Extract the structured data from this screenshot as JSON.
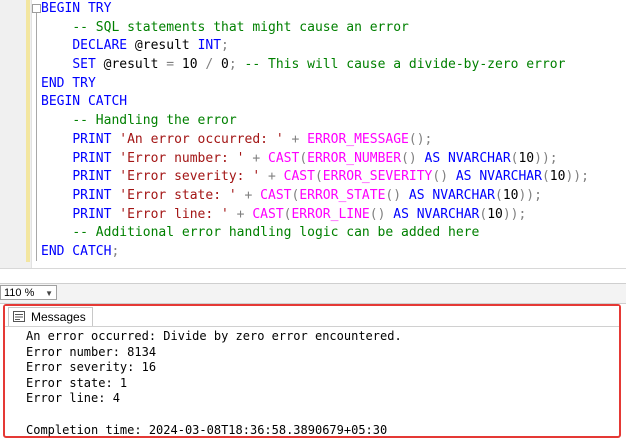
{
  "editor": {
    "lines": [
      [
        {
          "t": "BEGIN TRY",
          "c": "kw"
        }
      ],
      [
        {
          "t": "    "
        },
        {
          "t": "-- SQL statements that might cause an error",
          "c": "cm"
        }
      ],
      [
        {
          "t": "    "
        },
        {
          "t": "DECLARE",
          "c": "kw"
        },
        {
          "t": " @result "
        },
        {
          "t": "INT",
          "c": "kw"
        },
        {
          "t": ";",
          "c": "gray"
        }
      ],
      [
        {
          "t": "    "
        },
        {
          "t": "SET",
          "c": "kw"
        },
        {
          "t": " @result "
        },
        {
          "t": "=",
          "c": "gray"
        },
        {
          "t": " 10 "
        },
        {
          "t": "/",
          "c": "gray"
        },
        {
          "t": " 0"
        },
        {
          "t": ";",
          "c": "gray"
        },
        {
          "t": " "
        },
        {
          "t": "-- This will cause a divide-by-zero error",
          "c": "cm"
        }
      ],
      [
        {
          "t": "END TRY",
          "c": "kw"
        }
      ],
      [
        {
          "t": "BEGIN CATCH",
          "c": "kw"
        }
      ],
      [
        {
          "t": "    "
        },
        {
          "t": "-- Handling the error",
          "c": "cm"
        }
      ],
      [
        {
          "t": "    "
        },
        {
          "t": "PRINT",
          "c": "kw"
        },
        {
          "t": " "
        },
        {
          "t": "'An error occurred: '",
          "c": "st"
        },
        {
          "t": " + ",
          "c": "gray"
        },
        {
          "t": "ERROR_MESSAGE",
          "c": "fn"
        },
        {
          "t": "();",
          "c": "gray"
        }
      ],
      [
        {
          "t": "    "
        },
        {
          "t": "PRINT",
          "c": "kw"
        },
        {
          "t": " "
        },
        {
          "t": "'Error number: '",
          "c": "st"
        },
        {
          "t": " + ",
          "c": "gray"
        },
        {
          "t": "CAST",
          "c": "fn"
        },
        {
          "t": "(",
          "c": "gray"
        },
        {
          "t": "ERROR_NUMBER",
          "c": "fn"
        },
        {
          "t": "() ",
          "c": "gray"
        },
        {
          "t": "AS",
          "c": "kw"
        },
        {
          "t": " "
        },
        {
          "t": "NVARCHAR",
          "c": "kw"
        },
        {
          "t": "(",
          "c": "gray"
        },
        {
          "t": "10"
        },
        {
          "t": "));",
          "c": "gray"
        }
      ],
      [
        {
          "t": "    "
        },
        {
          "t": "PRINT",
          "c": "kw"
        },
        {
          "t": " "
        },
        {
          "t": "'Error severity: '",
          "c": "st"
        },
        {
          "t": " + ",
          "c": "gray"
        },
        {
          "t": "CAST",
          "c": "fn"
        },
        {
          "t": "(",
          "c": "gray"
        },
        {
          "t": "ERROR_SEVERITY",
          "c": "fn"
        },
        {
          "t": "() ",
          "c": "gray"
        },
        {
          "t": "AS",
          "c": "kw"
        },
        {
          "t": " "
        },
        {
          "t": "NVARCHAR",
          "c": "kw"
        },
        {
          "t": "(",
          "c": "gray"
        },
        {
          "t": "10"
        },
        {
          "t": "));",
          "c": "gray"
        }
      ],
      [
        {
          "t": "    "
        },
        {
          "t": "PRINT",
          "c": "kw"
        },
        {
          "t": " "
        },
        {
          "t": "'Error state: '",
          "c": "st"
        },
        {
          "t": " + ",
          "c": "gray"
        },
        {
          "t": "CAST",
          "c": "fn"
        },
        {
          "t": "(",
          "c": "gray"
        },
        {
          "t": "ERROR_STATE",
          "c": "fn"
        },
        {
          "t": "() ",
          "c": "gray"
        },
        {
          "t": "AS",
          "c": "kw"
        },
        {
          "t": " "
        },
        {
          "t": "NVARCHAR",
          "c": "kw"
        },
        {
          "t": "(",
          "c": "gray"
        },
        {
          "t": "10"
        },
        {
          "t": "));",
          "c": "gray"
        }
      ],
      [
        {
          "t": "    "
        },
        {
          "t": "PRINT",
          "c": "kw"
        },
        {
          "t": " "
        },
        {
          "t": "'Error line: '",
          "c": "st"
        },
        {
          "t": " + ",
          "c": "gray"
        },
        {
          "t": "CAST",
          "c": "fn"
        },
        {
          "t": "(",
          "c": "gray"
        },
        {
          "t": "ERROR_LINE",
          "c": "fn"
        },
        {
          "t": "() ",
          "c": "gray"
        },
        {
          "t": "AS",
          "c": "kw"
        },
        {
          "t": " "
        },
        {
          "t": "NVARCHAR",
          "c": "kw"
        },
        {
          "t": "(",
          "c": "gray"
        },
        {
          "t": "10"
        },
        {
          "t": "));",
          "c": "gray"
        }
      ],
      [
        {
          "t": "    "
        },
        {
          "t": "-- Additional error handling logic can be added here",
          "c": "cm"
        }
      ],
      [
        {
          "t": "END CATCH",
          "c": "kw"
        },
        {
          "t": ";",
          "c": "gray"
        }
      ]
    ]
  },
  "status": {
    "zoom": "110 %"
  },
  "results": {
    "tab_label": "Messages",
    "messages": [
      "An error occurred: Divide by zero error encountered.",
      "Error number: 8134",
      "Error severity: 16",
      "Error state: 1",
      "Error line: 4",
      "",
      "Completion time: 2024-03-08T18:36:58.3890679+05:30"
    ]
  },
  "colors": {
    "highlight_border": "#e53935",
    "keyword": "#0000ff",
    "comment": "#008000",
    "function": "#ff00ff",
    "string": "#a31515"
  }
}
